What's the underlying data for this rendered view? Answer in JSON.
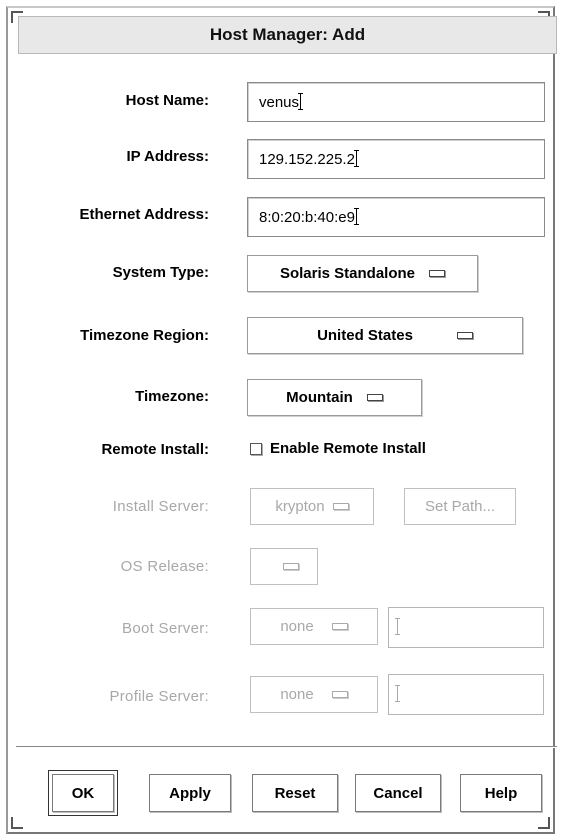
{
  "window": {
    "title": "Host Manager: Add"
  },
  "form": {
    "host_name": {
      "label": "Host Name:",
      "value": "venus"
    },
    "ip_address": {
      "label": "IP Address:",
      "value": "129.152.225.2"
    },
    "ethernet_address": {
      "label": "Ethernet Address:",
      "value": "8:0:20:b:40:e9"
    },
    "system_type": {
      "label": "System Type:",
      "value": "Solaris Standalone"
    },
    "timezone_region": {
      "label": "Timezone Region:",
      "value": "United States"
    },
    "timezone": {
      "label": "Timezone:",
      "value": "Mountain"
    },
    "remote_install": {
      "label": "Remote Install:",
      "checkbox_label": "Enable Remote Install",
      "checked": false
    },
    "install_server": {
      "label": "Install Server:",
      "value": "krypton",
      "set_path_label": "Set Path..."
    },
    "os_release": {
      "label": "OS Release:",
      "value": ""
    },
    "boot_server": {
      "label": "Boot Server:",
      "value": "none",
      "path": ""
    },
    "profile_server": {
      "label": "Profile Server:",
      "value": "none",
      "path": ""
    }
  },
  "buttons": {
    "ok": "OK",
    "apply": "Apply",
    "reset": "Reset",
    "cancel": "Cancel",
    "help": "Help"
  },
  "colors": {
    "enabled_text": "#000000",
    "disabled_text": "#a8a8a8",
    "background": "#ffffff"
  }
}
